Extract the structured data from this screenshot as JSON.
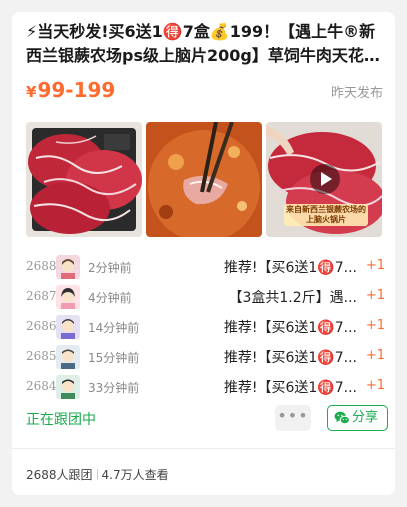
{
  "post": {
    "title": "⚡当天秒发!买6送1🉐7盒💰199！【遇上牛®新西兰银蕨农场ps级上脑片200g】草饲牛肉天花板…",
    "price_symbol": "¥",
    "price_range": "99-199",
    "published": "昨天发布",
    "video_caption": "来自新西兰银蕨农场的上脑火锅片"
  },
  "rows": [
    {
      "num": "2688",
      "ago": "2分钟前",
      "msg": "推荐!【买6送1🉐7...",
      "plus": "+1"
    },
    {
      "num": "2687",
      "ago": "4分钟前",
      "msg": "【3盒共1.2斤】遇...",
      "plus": "+1"
    },
    {
      "num": "2686",
      "ago": "14分钟前",
      "msg": "推荐!【买6送1🉐7...",
      "plus": "+1"
    },
    {
      "num": "2685",
      "ago": "15分钟前",
      "msg": "推荐!【买6送1🉐7...",
      "plus": "+1"
    },
    {
      "num": "2684",
      "ago": "33分钟前",
      "msg": "推荐!【买6送1🉐7...",
      "plus": "+1"
    }
  ],
  "footer": {
    "status": "正在跟团中",
    "more": "•••",
    "share": "分享",
    "joined": "2688人跟团",
    "views": "4.7万人查看"
  },
  "colors": {
    "accent": "#ff6a2f",
    "green": "#19ab4c"
  }
}
